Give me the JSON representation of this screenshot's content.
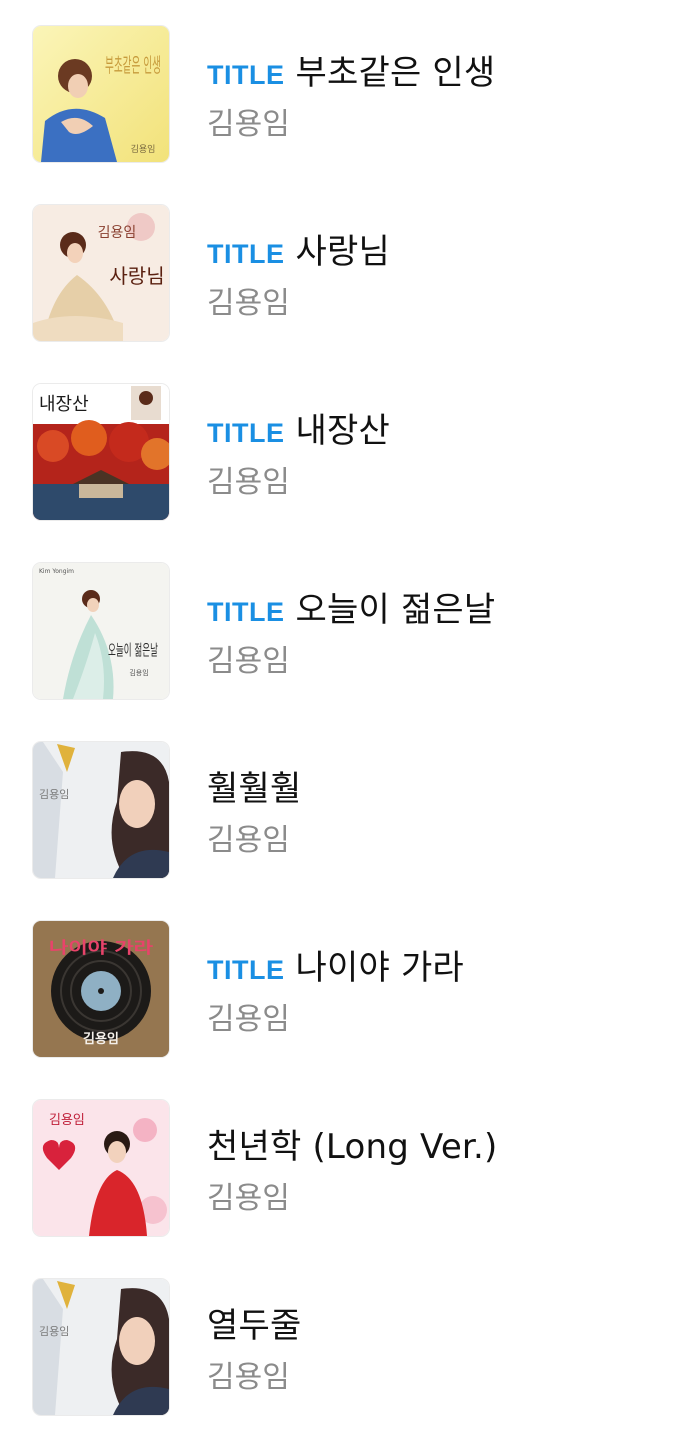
{
  "songs": [
    {
      "badge": "TITLE",
      "title": "부초같은 인생",
      "artist": "김용임",
      "is_title": true,
      "cover": {
        "name": "album-cover-buchogateun-insaeng",
        "texts": [
          "부초같은 인생",
          "김용임"
        ]
      }
    },
    {
      "badge": "TITLE",
      "title": "사랑님",
      "artist": "김용임",
      "is_title": true,
      "cover": {
        "name": "album-cover-sarangnim",
        "texts": [
          "김용임",
          "사랑님"
        ]
      }
    },
    {
      "badge": "TITLE",
      "title": "내장산",
      "artist": "김용임",
      "is_title": true,
      "cover": {
        "name": "album-cover-naejangsan",
        "texts": [
          "내장산"
        ]
      }
    },
    {
      "badge": "TITLE",
      "title": "오늘이 젊은날",
      "artist": "김용임",
      "is_title": true,
      "cover": {
        "name": "album-cover-oneuri-jeolmeunnal",
        "texts": [
          "Kim Yongim",
          "오늘이 젊은날",
          "김용임"
        ]
      }
    },
    {
      "badge": "",
      "title": "훨훨훨",
      "artist": "김용임",
      "is_title": false,
      "cover": {
        "name": "album-cover-hwolhwolhwol",
        "texts": [
          "김용임"
        ]
      }
    },
    {
      "badge": "TITLE",
      "title": "나이야 가라",
      "artist": "김용임",
      "is_title": true,
      "cover": {
        "name": "album-cover-naiya-gara",
        "texts": [
          "나이야 가라",
          "김용임"
        ]
      }
    },
    {
      "badge": "",
      "title": "천년학 (Long Ver.)",
      "artist": "김용임",
      "is_title": false,
      "cover": {
        "name": "album-cover-cheonnyeonhak",
        "texts": [
          "김용임"
        ]
      }
    },
    {
      "badge": "",
      "title": "열두줄",
      "artist": "김용임",
      "is_title": false,
      "cover": {
        "name": "album-cover-yeoldujul",
        "texts": [
          "김용임"
        ]
      }
    }
  ],
  "colors": {
    "badge": "#1a8fe3",
    "title": "#111111",
    "artist": "#8b8b8b",
    "background": "#ffffff"
  }
}
